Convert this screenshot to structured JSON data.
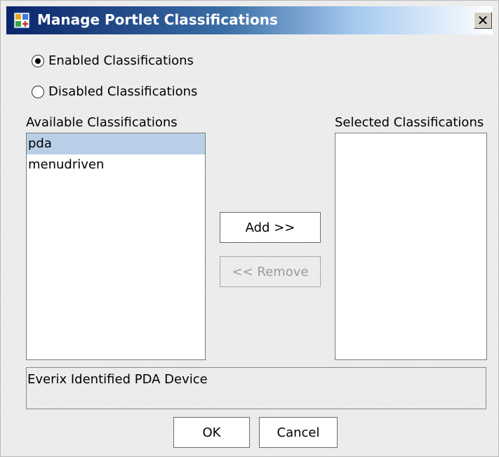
{
  "window": {
    "title": "Manage Portlet Classifications",
    "close_symbol": "✕",
    "icon": "portlet-app-icon"
  },
  "radios": {
    "enabled": {
      "label": "Enabled Classifications",
      "checked": true
    },
    "disabled": {
      "label": "Disabled Classifications",
      "checked": false
    }
  },
  "available": {
    "label": "Available Classifications",
    "items": [
      "pda",
      "menudriven"
    ],
    "selected_index": 0
  },
  "selected": {
    "label": "Selected Classifications",
    "items": []
  },
  "buttons": {
    "add": "Add >>",
    "remove": "<< Remove",
    "ok": "OK",
    "cancel": "Cancel"
  },
  "description": "Everix Identified PDA Device",
  "colors": {
    "titlebar_start": "#0a246a",
    "selection": "#b9cfe8"
  }
}
